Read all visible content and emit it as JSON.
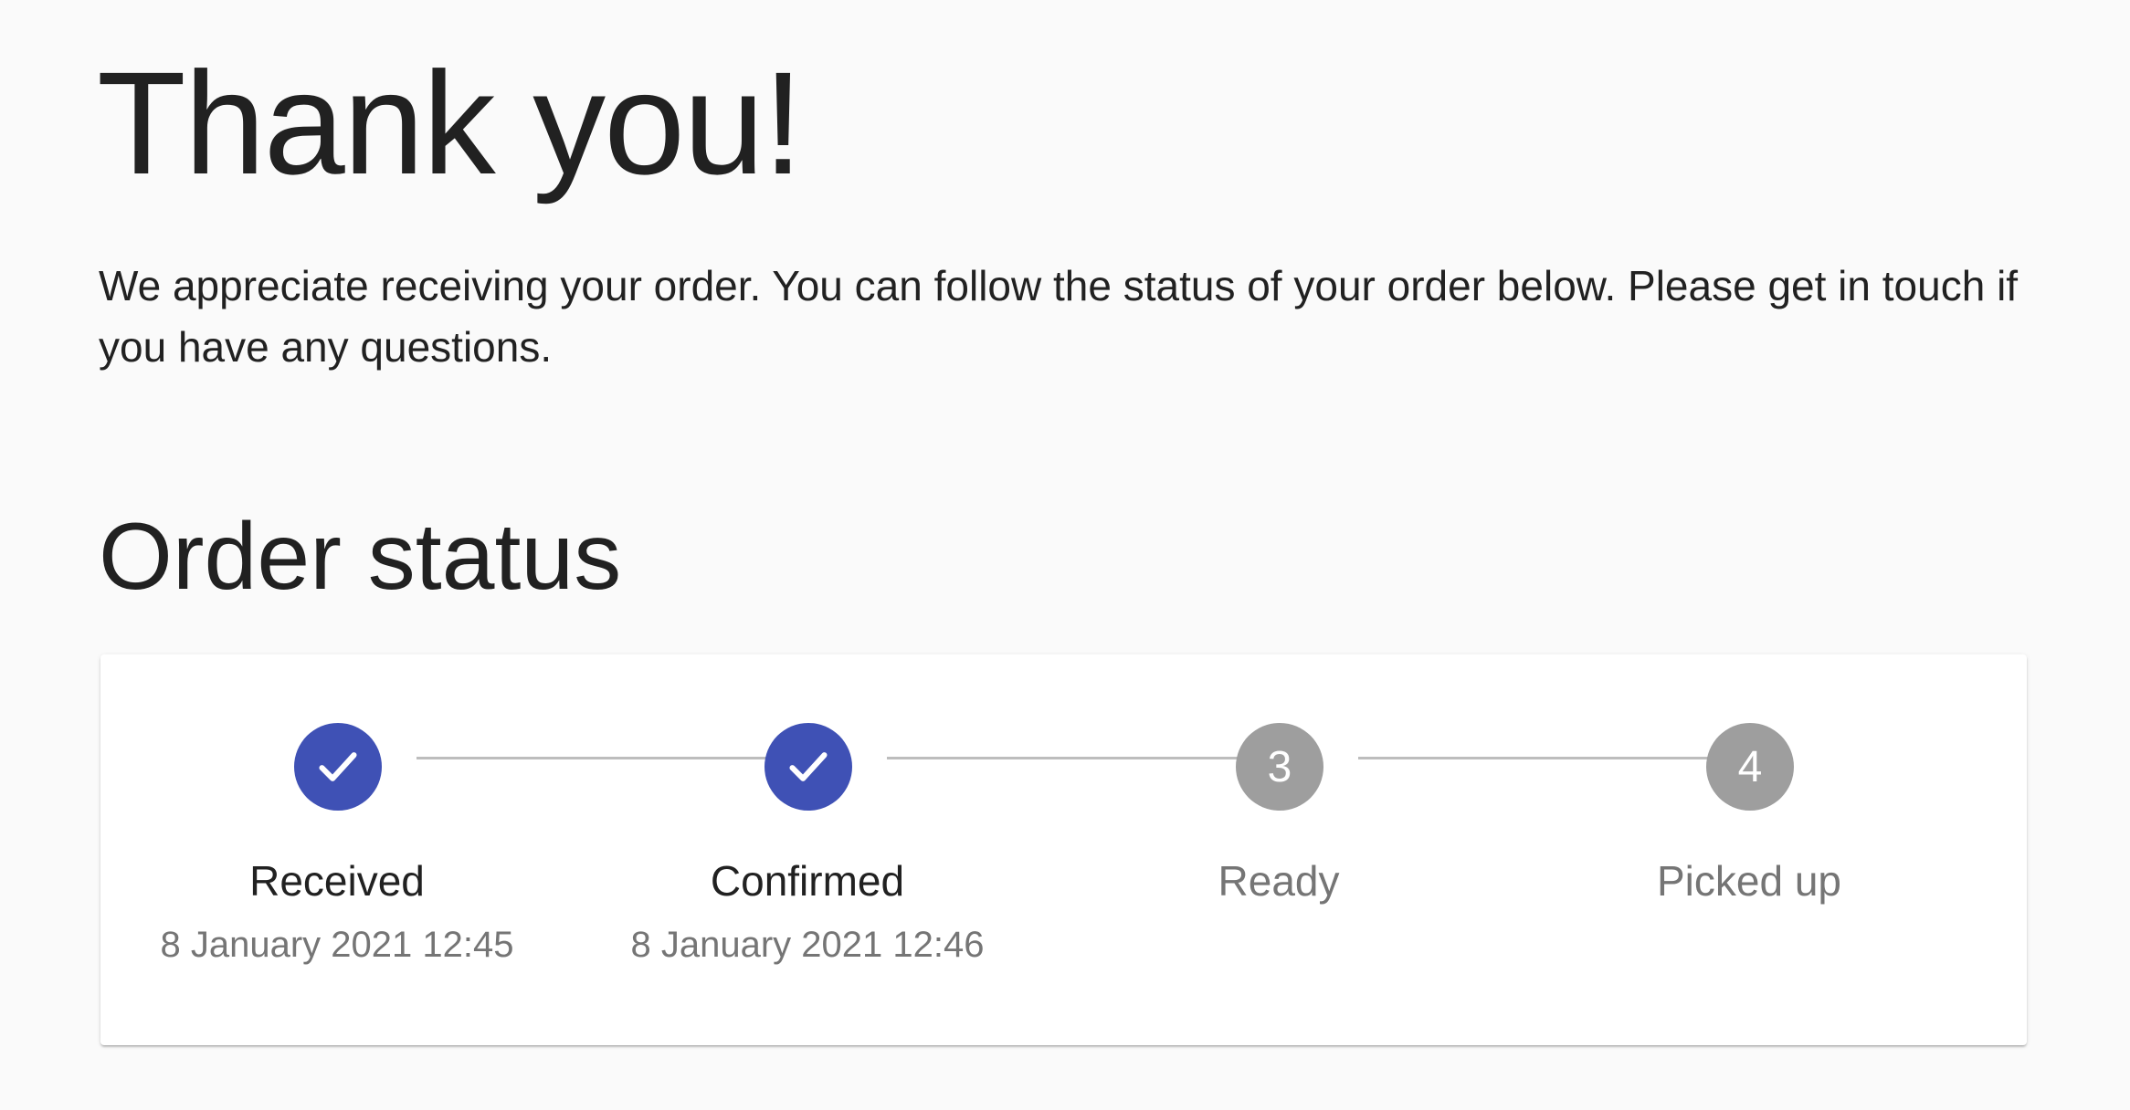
{
  "heading": "Thank you!",
  "intro": "We appreciate receiving your order. You can follow the status of your order below. Please get in touch if you have any questions.",
  "order_status": {
    "title": "Order status",
    "steps": [
      {
        "label": "Received",
        "date": "8 January 2021 12:45",
        "state": "completed",
        "icon": "check-icon"
      },
      {
        "label": "Confirmed",
        "date": "8 January 2021 12:46",
        "state": "completed",
        "icon": "check-icon"
      },
      {
        "label": "Ready",
        "number": "3",
        "state": "pending"
      },
      {
        "label": "Picked up",
        "number": "4",
        "state": "pending"
      }
    ]
  },
  "colors": {
    "completed": "#3f51b5",
    "pending": "#9e9e9e",
    "pending_label": "#757575",
    "completed_label": "#212121",
    "connector": "#bdbdbd"
  }
}
